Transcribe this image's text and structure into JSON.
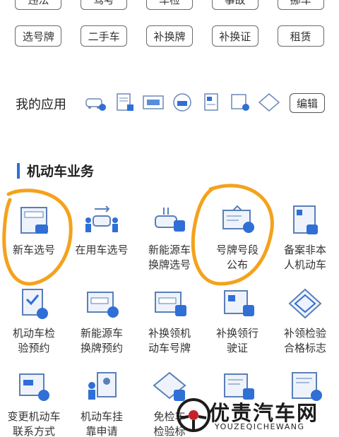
{
  "top_chips_cut": [
    "违法",
    "驾考",
    "车检",
    "事故",
    "挪车"
  ],
  "top_chips": [
    "选号牌",
    "二手车",
    "补换牌",
    "补换证",
    "租赁"
  ],
  "my_apps": {
    "title": "我的应用",
    "icons": [
      "car-blue-icon",
      "document-icon",
      "license-plate-icon",
      "plate-replace-icon",
      "card-icon",
      "certificate-icon",
      "exempt-icon"
    ],
    "edit_label": "编辑"
  },
  "section": {
    "title": "机动车业务",
    "accent": "#2f6fd6"
  },
  "grid": [
    {
      "label1": "新车选号",
      "label2": "",
      "icon": "new-plate-select-icon"
    },
    {
      "label1": "在用车选号",
      "label2": "",
      "icon": "used-car-select-icon"
    },
    {
      "label1": "新能源车",
      "label2": "换牌选号",
      "icon": "ev-plate-change-icon"
    },
    {
      "label1": "号牌号段",
      "label2": "公布",
      "icon": "plate-segment-announce-icon"
    },
    {
      "label1": "备案非本",
      "label2": "人机动车",
      "icon": "register-other-owner-icon"
    },
    {
      "label1": "机动车检",
      "label2": "验预约",
      "icon": "inspection-reservation-icon"
    },
    {
      "label1": "新能源车",
      "label2": "换牌预约",
      "icon": "ev-change-reservation-icon"
    },
    {
      "label1": "补换领机",
      "label2": "动车号牌",
      "icon": "replace-plate-icon"
    },
    {
      "label1": "补换领行",
      "label2": "驶证",
      "icon": "replace-license-icon"
    },
    {
      "label1": "补领检验",
      "label2": "合格标志",
      "icon": "inspection-mark-icon"
    },
    {
      "label1": "变更机动车",
      "label2": "联系方式",
      "icon": "change-contact-icon"
    },
    {
      "label1": "机动车挂",
      "label2": "靠申请",
      "icon": "affiliation-apply-icon"
    },
    {
      "label1": "免检车",
      "label2": "检验标",
      "icon": "exempt-mark-icon"
    },
    {
      "label1": "",
      "label2": "",
      "icon": "transfer-icon"
    },
    {
      "label1": "",
      "label2": "",
      "icon": "change-icon"
    }
  ],
  "watermark": {
    "text": "优责汽车网",
    "sub": "YOUZEQICHEWANG"
  },
  "highlight_color": "#f4a21c"
}
